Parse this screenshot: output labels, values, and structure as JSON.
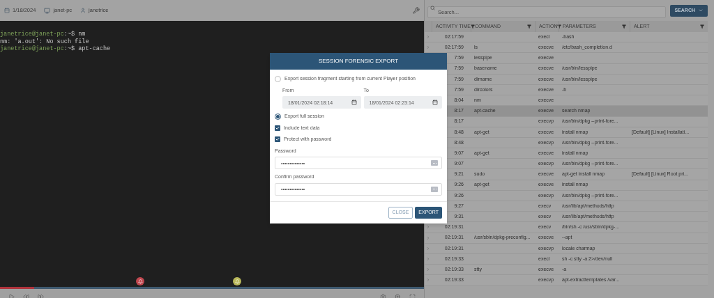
{
  "session_bar": {
    "date": "1/18/2024",
    "host": "janet-pc",
    "user": "janetrice"
  },
  "terminal": {
    "lines": [
      {
        "kind": "command",
        "user": "janetrice@janet-pc",
        "path": ":~$",
        "command": " nm"
      },
      {
        "kind": "output",
        "text": "nm: 'a.out': No such file"
      },
      {
        "kind": "command",
        "user": "janetrice@janet-pc",
        "path": ":~$",
        "command": " apt-cache"
      }
    ]
  },
  "timeline": {
    "level": 0.08,
    "markers": [
      {
        "color": "#c0474f"
      },
      {
        "color": "#b9b85a"
      }
    ]
  },
  "search": {
    "placeholder": "Search...",
    "button": "SEARCH"
  },
  "table": {
    "columns": [
      "ACTIVITY TIME",
      "COMMAND",
      "ACTION",
      "PARAMETERS",
      "ALERT"
    ],
    "rows": [
      {
        "time": "02:17:59",
        "command": "",
        "action": "execl",
        "parameters": "-bash",
        "alert": "",
        "selected": false
      },
      {
        "time": "02:17:59",
        "command": "ls",
        "action": "execve",
        "parameters": "/etc/bash_completion.d",
        "alert": "",
        "selected": false
      },
      {
        "time": "7:59",
        "command": "lesspipe",
        "action": "execve",
        "parameters": "",
        "alert": "",
        "selected": false
      },
      {
        "time": "7:59",
        "command": "basename",
        "action": "execve",
        "parameters": "/usr/bin/lesspipe",
        "alert": "",
        "selected": false
      },
      {
        "time": "7:59",
        "command": "dirname",
        "action": "execve",
        "parameters": "/usr/bin/lesspipe",
        "alert": "",
        "selected": false
      },
      {
        "time": "7:59",
        "command": "dircolors",
        "action": "execve",
        "parameters": "-b",
        "alert": "",
        "selected": false
      },
      {
        "time": "8:04",
        "command": "nm",
        "action": "execve",
        "parameters": "",
        "alert": "",
        "selected": false
      },
      {
        "time": "8:17",
        "command": "apt-cache",
        "action": "execve",
        "parameters": "search nmap",
        "alert": "",
        "selected": true
      },
      {
        "time": "8:17",
        "command": "",
        "action": "execvp",
        "parameters": "/usr/bin/dpkg --print-fore...",
        "alert": "",
        "selected": false
      },
      {
        "time": "8:48",
        "command": "apt-get",
        "action": "execve",
        "parameters": "install nmap",
        "alert": "[Default] [Linux] Installati...",
        "selected": false
      },
      {
        "time": "8:48",
        "command": "",
        "action": "execvp",
        "parameters": "/usr/bin/dpkg --print-fore...",
        "alert": "",
        "selected": false
      },
      {
        "time": "9:07",
        "command": "apt-get",
        "action": "execve",
        "parameters": "install nmap",
        "alert": "",
        "selected": false
      },
      {
        "time": "9:07",
        "command": "",
        "action": "execvp",
        "parameters": "/usr/bin/dpkg --print-fore...",
        "alert": "",
        "selected": false
      },
      {
        "time": "9:21",
        "command": "sudo",
        "action": "execve",
        "parameters": "apt-get install nmap",
        "alert": "[Default] [Linux] Root pri...",
        "selected": false
      },
      {
        "time": "9:26",
        "command": "apt-get",
        "action": "execve",
        "parameters": "install nmap",
        "alert": "",
        "selected": false
      },
      {
        "time": "9:26",
        "command": "",
        "action": "execvp",
        "parameters": "/usr/bin/dpkg --print-fore...",
        "alert": "",
        "selected": false
      },
      {
        "time": "9:27",
        "command": "",
        "action": "execv",
        "parameters": "/usr/lib/apt/methods/http",
        "alert": "",
        "selected": false
      },
      {
        "time": "9:31",
        "command": "",
        "action": "execv",
        "parameters": "/usr/lib/apt/methods/http",
        "alert": "",
        "selected": false
      },
      {
        "time": "02:19:31",
        "command": "",
        "action": "execv",
        "parameters": "/bin/sh -c /usr/sbin/dpkg-...",
        "alert": "",
        "selected": false
      },
      {
        "time": "02:19:31",
        "command": "/usr/sbin/dpkg-preconfig...",
        "action": "execve",
        "parameters": "--apt",
        "alert": "",
        "selected": false
      },
      {
        "time": "02:19:31",
        "command": "",
        "action": "execvp",
        "parameters": "locale charmap",
        "alert": "",
        "selected": false
      },
      {
        "time": "02:19:33",
        "command": "",
        "action": "execl",
        "parameters": "sh -c stty -a 2>/dev/null",
        "alert": "",
        "selected": false
      },
      {
        "time": "02:19:33",
        "command": "stty",
        "action": "execve",
        "parameters": "-a",
        "alert": "",
        "selected": false
      },
      {
        "time": "02:19:33",
        "command": "",
        "action": "execvp",
        "parameters": "apt-extracttemplates /var...",
        "alert": "",
        "selected": false
      }
    ]
  },
  "dialog": {
    "title": "SESSION FORENSIC EXPORT",
    "fragment_option": {
      "label": "Export session fragment starting from current Player position",
      "selected": false
    },
    "from": {
      "label": "From",
      "value": "18/01/2024 02:18:14"
    },
    "to": {
      "label": "To",
      "value": "18/01/2024 02:23:14"
    },
    "full_option": {
      "label": "Export full session",
      "selected": true
    },
    "checkboxes": [
      {
        "label": "Include text data",
        "checked": true
      },
      {
        "label": "Protect with password",
        "checked": true
      }
    ],
    "password": {
      "label": "Password",
      "value": "••••••••••••••"
    },
    "confirm_password": {
      "label": "Confirm password",
      "value": "••••••••••••••"
    },
    "buttons": {
      "close": "CLOSE",
      "export": "EXPORT"
    }
  }
}
